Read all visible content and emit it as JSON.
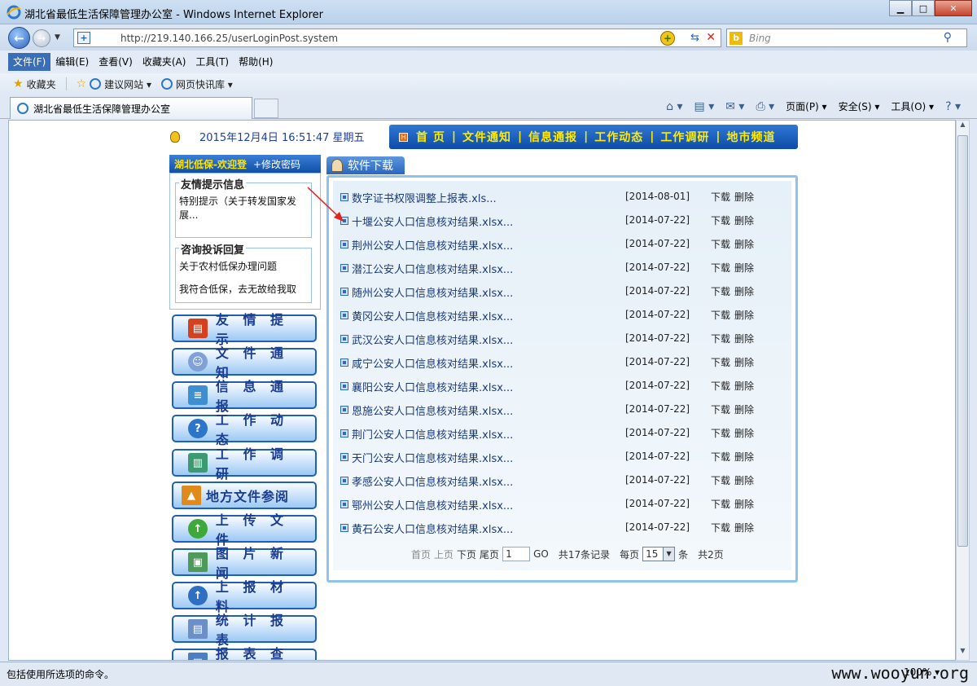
{
  "window": {
    "title": "湖北省最低生活保障管理办公室 - Windows Internet Explorer"
  },
  "address": {
    "url": "http://219.140.166.25/userLoginPost.system",
    "search_placeholder": "Bing"
  },
  "menu": [
    "文件(F)",
    "编辑(E)",
    "查看(V)",
    "收藏夹(A)",
    "工具(T)",
    "帮助(H)"
  ],
  "favorites": {
    "label": "收藏夹",
    "items": [
      "建议网站 ▾",
      "网页快讯库 ▾"
    ]
  },
  "tab": {
    "title": "湖北省最低生活保障管理办公室"
  },
  "commandbar": {
    "page": "页面(P) ▾",
    "safety": "安全(S) ▾",
    "tools": "工具(O) ▾"
  },
  "page": {
    "datetime": "2015年12月4日  16:51:47 星期五",
    "nav": [
      "首 页",
      "文件通知",
      "信息通报",
      "工作动态",
      "工作调研",
      "地市频道"
    ],
    "user_header": {
      "welcome": "湖北低保-欢迎登",
      "change_password": "+修改密码"
    },
    "friendly_tips": {
      "legend": "友情提示信息",
      "text": "特别提示（关于转发国家发展..."
    },
    "consult": {
      "legend": "咨询投诉回复",
      "line1": "关于农村低保办理问题",
      "line2": "我符合低保，去无故给我取"
    },
    "side_menu": [
      "友 情 提 示",
      "文 件 通 知",
      "信 息 通 报",
      "工 作 动 态",
      "工 作 调 研",
      "地方文件参阅",
      "上 传 文 件",
      "图 片 新 闻",
      "上 报 材 料",
      "统 计 报 表",
      "报 表 查 询"
    ],
    "panel_title": "软件下载",
    "files": [
      {
        "name": "数字证书权限调整上报表.xls...",
        "date": "[2014-08-01]"
      },
      {
        "name": "十堰公安人口信息核对结果.xlsx...",
        "date": "[2014-07-22]"
      },
      {
        "name": "荆州公安人口信息核对结果.xlsx...",
        "date": "[2014-07-22]"
      },
      {
        "name": "潜江公安人口信息核对结果.xlsx...",
        "date": "[2014-07-22]"
      },
      {
        "name": "随州公安人口信息核对结果.xlsx...",
        "date": "[2014-07-22]"
      },
      {
        "name": "黄冈公安人口信息核对结果.xlsx...",
        "date": "[2014-07-22]"
      },
      {
        "name": "武汉公安人口信息核对结果.xlsx...",
        "date": "[2014-07-22]"
      },
      {
        "name": "咸宁公安人口信息核对结果.xlsx...",
        "date": "[2014-07-22]"
      },
      {
        "name": "襄阳公安人口信息核对结果.xlsx...",
        "date": "[2014-07-22]"
      },
      {
        "name": "恩施公安人口信息核对结果.xlsx...",
        "date": "[2014-07-22]"
      },
      {
        "name": "荆门公安人口信息核对结果.xlsx...",
        "date": "[2014-07-22]"
      },
      {
        "name": "天门公安人口信息核对结果.xlsx...",
        "date": "[2014-07-22]"
      },
      {
        "name": "孝感公安人口信息核对结果.xlsx...",
        "date": "[2014-07-22]"
      },
      {
        "name": "鄂州公安人口信息核对结果.xlsx...",
        "date": "[2014-07-22]"
      },
      {
        "name": "黄石公安人口信息核对结果.xlsx...",
        "date": "[2014-07-22]"
      }
    ],
    "file_actions": {
      "download": "下载",
      "delete": "删除"
    },
    "pager": {
      "first": "首页",
      "prev": "上页",
      "next": "下页",
      "last": "尾页",
      "page_value": "1",
      "go": "GO",
      "total": "共17条记录",
      "per_page_label": "每页",
      "per_page_value": "15",
      "unit": "条",
      "total_pages": "共2页"
    }
  },
  "status": {
    "text": "包括使用所选项的命令。",
    "zoom": "100% ▾",
    "watermark": "www.wooyun.org"
  }
}
